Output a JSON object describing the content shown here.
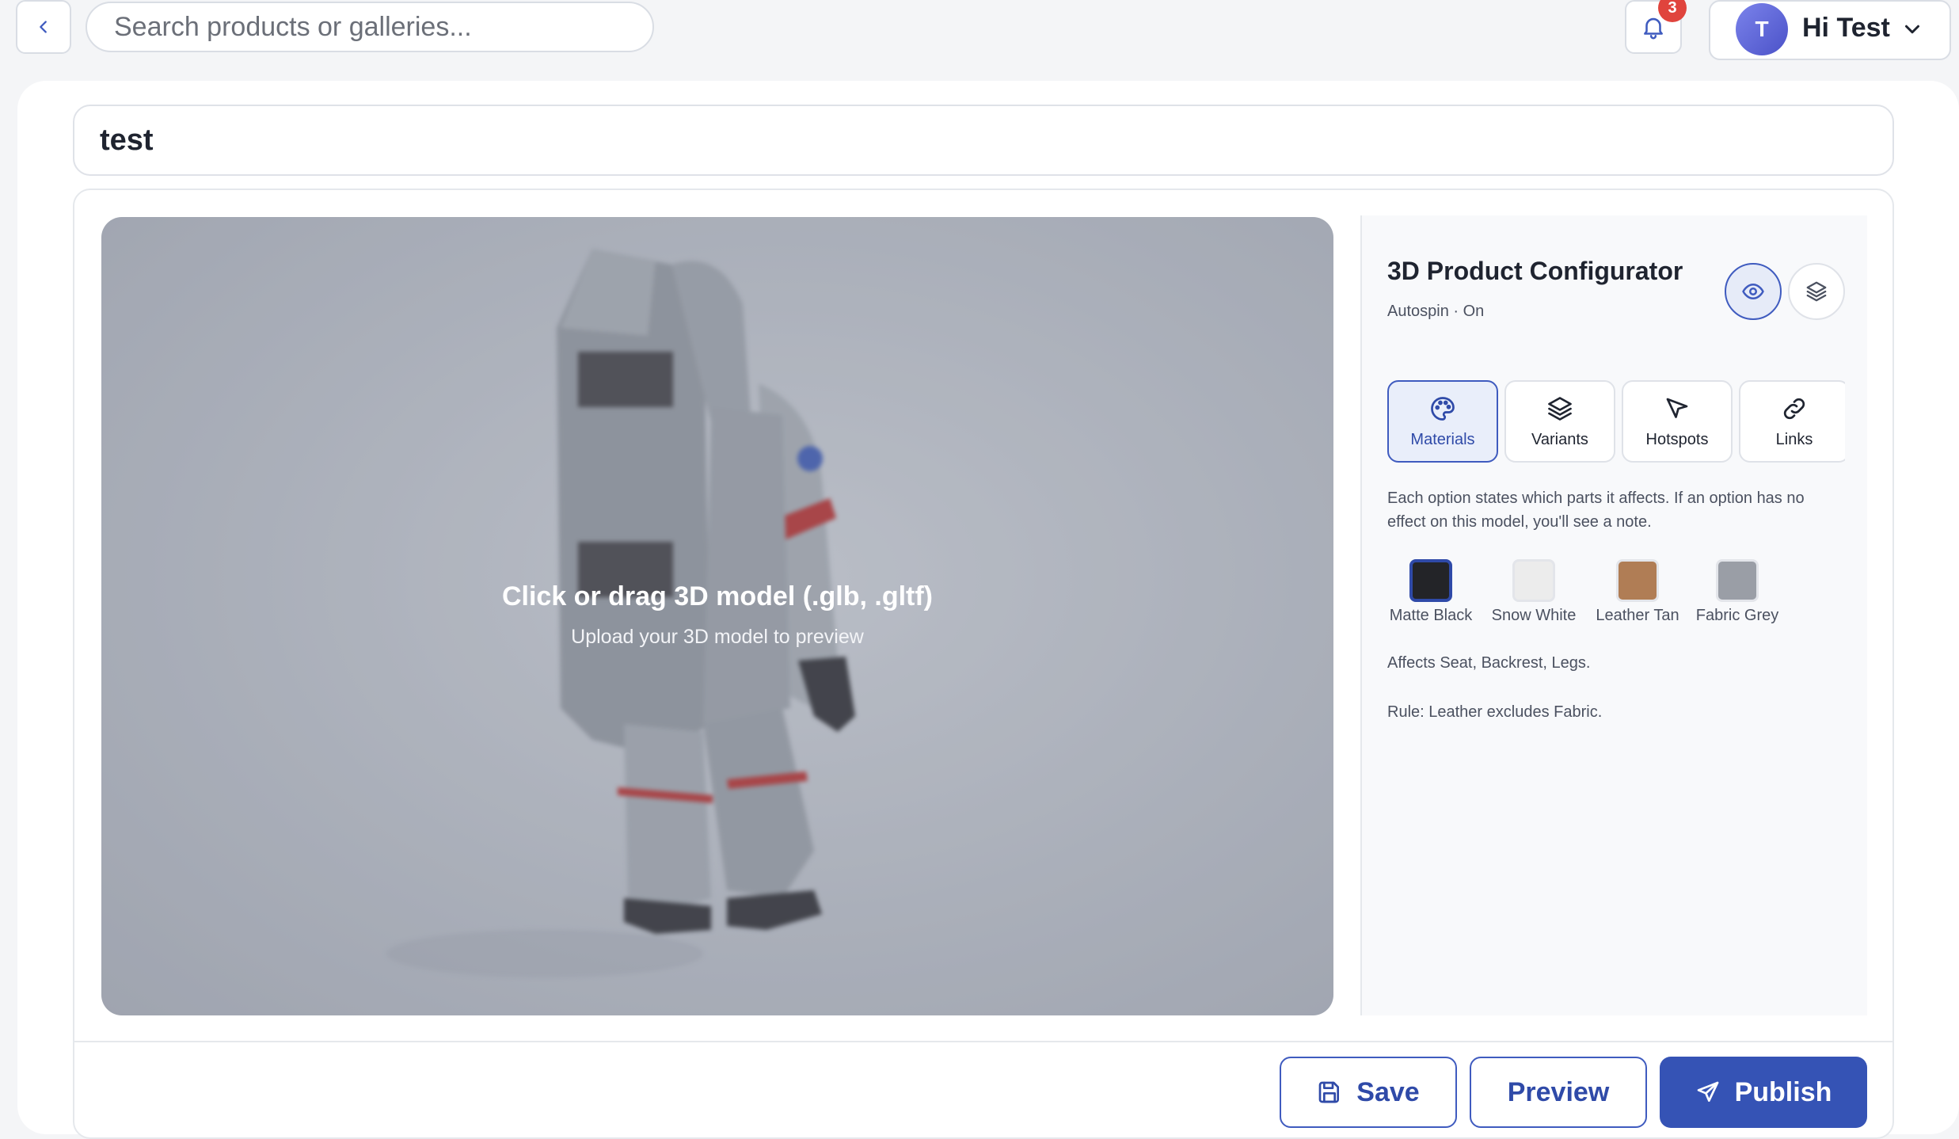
{
  "header": {
    "search_placeholder": "Search products or galleries...",
    "notification_count": "3",
    "user_initial": "T",
    "user_greeting": "Hi Test"
  },
  "project": {
    "title": "test"
  },
  "viewer": {
    "drop_title": "Click or drag 3D model (.glb, .gltf)",
    "drop_subtitle": "Upload your 3D model to preview"
  },
  "configurator": {
    "title": "3D Product Configurator",
    "subtitle": "Autospin · On",
    "tabs": [
      {
        "label": "Materials",
        "icon": "palette-icon",
        "active": true
      },
      {
        "label": "Variants",
        "icon": "layers-icon",
        "active": false
      },
      {
        "label": "Hotspots",
        "icon": "cursor-icon",
        "active": false
      },
      {
        "label": "Links",
        "icon": "link-icon",
        "active": false
      }
    ],
    "description": "Each option states which parts it affects. If an option has no effect on this model, you'll see a note.",
    "swatches": [
      {
        "label": "Matte Black",
        "color": "#232428",
        "selected": true
      },
      {
        "label": "Snow White",
        "color": "#ececec",
        "selected": false
      },
      {
        "label": "Leather Tan",
        "color": "#b07d55",
        "selected": false
      },
      {
        "label": "Fabric Grey",
        "color": "#9a9ea6",
        "selected": false
      }
    ],
    "affects": "Affects Seat, Backrest, Legs.",
    "rule": "Rule: Leather excludes Fabric."
  },
  "actions": {
    "save": "Save",
    "preview": "Preview",
    "publish": "Publish"
  },
  "colors": {
    "accent": "#3553b5",
    "badge": "#e0443d"
  }
}
